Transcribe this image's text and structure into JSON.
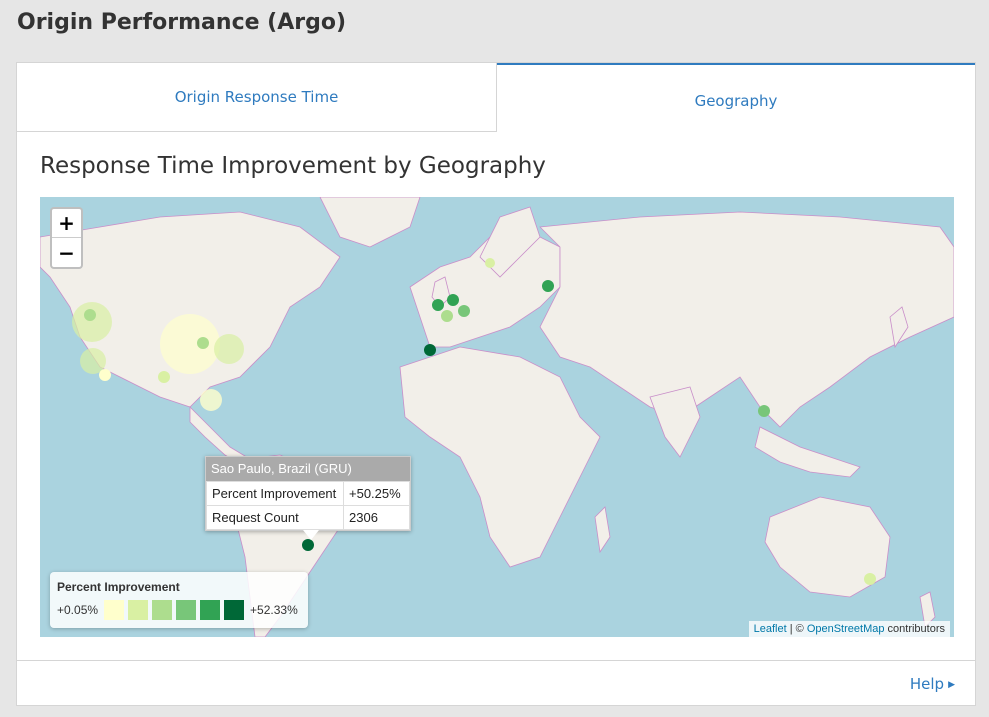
{
  "page": {
    "title": "Origin Performance (Argo)"
  },
  "tabs": [
    {
      "label": "Origin Response Time",
      "active": false
    },
    {
      "label": "Geography",
      "active": true
    }
  ],
  "section": {
    "title": "Response Time Improvement by Geography"
  },
  "map": {
    "zoom_in": "+",
    "zoom_out": "−",
    "tooltip": {
      "title": "Sao Paulo, Brazil (GRU)",
      "rows": [
        {
          "key": "Percent Improvement",
          "value": "+50.25%"
        },
        {
          "key": "Request Count",
          "value": "2306"
        }
      ]
    },
    "legend": {
      "title": "Percent Improvement",
      "min_label": "+0.05%",
      "max_label": "+52.33%",
      "colors": [
        "#ffffcc",
        "#d9f0a3",
        "#addd8e",
        "#78c679",
        "#31a354",
        "#006837"
      ]
    },
    "attribution": {
      "leaflet": "Leaflet",
      "separator": " | © ",
      "osm": "OpenStreetMap",
      "suffix": " contributors"
    },
    "colors": {
      "water": "#aad3df",
      "land": "#f2efe9",
      "border": "#c98ec9"
    }
  },
  "footer": {
    "help_label": "Help"
  }
}
